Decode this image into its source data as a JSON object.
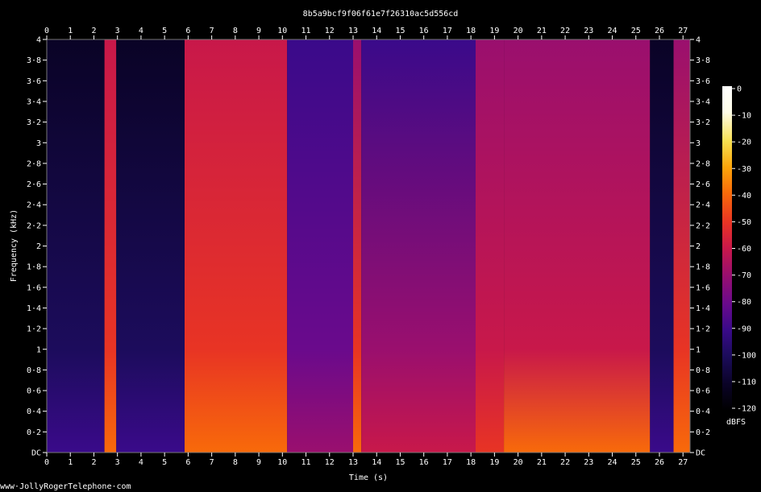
{
  "chart_data": {
    "type": "heatmap",
    "title": "8b5a9bcf9f06f61e7f26310ac5d556cd",
    "xlabel": "Time (s)",
    "ylabel": "Frequency (kHz)",
    "xlim": [
      0,
      27.3
    ],
    "ylim": [
      0,
      4
    ],
    "x_ticks": [
      "0",
      "1",
      "2",
      "3",
      "4",
      "5",
      "6",
      "7",
      "8",
      "9",
      "10",
      "11",
      "12",
      "13",
      "14",
      "15",
      "16",
      "17",
      "18",
      "19",
      "20",
      "21",
      "22",
      "23",
      "24",
      "25",
      "26",
      "27"
    ],
    "y_ticks": [
      "DC",
      "0·2",
      "0·4",
      "0·6",
      "0·8",
      "1",
      "1·2",
      "1·4",
      "1·6",
      "1·8",
      "2",
      "2·2",
      "2·4",
      "2·6",
      "2·8",
      "3",
      "3·2",
      "3·4",
      "3·6",
      "3·8",
      "4"
    ],
    "colorbar": {
      "label": "dBFS",
      "ticks": [
        "0",
        "-10",
        "-20",
        "-30",
        "-40",
        "-50",
        "-60",
        "-70",
        "-80",
        "-90",
        "-100",
        "-110",
        "-120"
      ],
      "range": [
        -120,
        0
      ],
      "colors": [
        "#000000",
        "#0a0326",
        "#1c0c5c",
        "#3a0a8a",
        "#6a0a8c",
        "#9a0f6e",
        "#c8184a",
        "#e83424",
        "#f86a0a",
        "#fca50a",
        "#f8e050",
        "#fffde8",
        "#ffffff"
      ]
    },
    "segments": [
      {
        "start": 0.0,
        "end": 2.45,
        "level": -105
      },
      {
        "start": 2.45,
        "end": 2.95,
        "level": -55
      },
      {
        "start": 2.95,
        "end": 5.85,
        "level": -108
      },
      {
        "start": 5.85,
        "end": 10.2,
        "level": -55
      },
      {
        "start": 10.2,
        "end": 13.0,
        "level": -85
      },
      {
        "start": 13.0,
        "end": 13.35,
        "level": -60
      },
      {
        "start": 13.35,
        "end": 18.2,
        "level": -80
      },
      {
        "start": 18.2,
        "end": 19.4,
        "level": -68
      },
      {
        "start": 19.4,
        "end": 25.6,
        "level": -62
      },
      {
        "start": 25.6,
        "end": 26.6,
        "level": -105
      },
      {
        "start": 26.6,
        "end": 27.3,
        "level": -60
      }
    ]
  },
  "watermark": "www·JollyRogerTelephone·com"
}
